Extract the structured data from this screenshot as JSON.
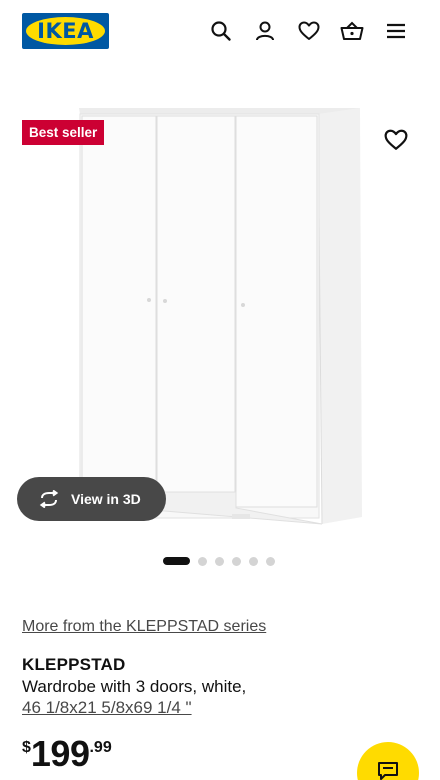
{
  "header": {
    "logo_text": "IKEA",
    "icons": [
      "search-icon",
      "account-icon",
      "heart-icon",
      "basket-icon",
      "menu-icon"
    ]
  },
  "product": {
    "badge": "Best seller",
    "view_3d_label": "View in 3D",
    "series_link": "More from the KLEPPSTAD series",
    "name": "KLEPPSTAD",
    "description": "Wardrobe with 3 doors, white,",
    "measurements": "46 1/8x21 5/8x69 1/4 \"",
    "price": {
      "currency": "$",
      "integer": "199",
      "decimals": ".99"
    }
  },
  "carousel": {
    "total_images": 6,
    "active_index": 0
  },
  "colors": {
    "brand_blue": "#0058a3",
    "brand_yellow": "#ffdb00",
    "badge_red": "#cc0033",
    "pill_gray": "#484848"
  }
}
